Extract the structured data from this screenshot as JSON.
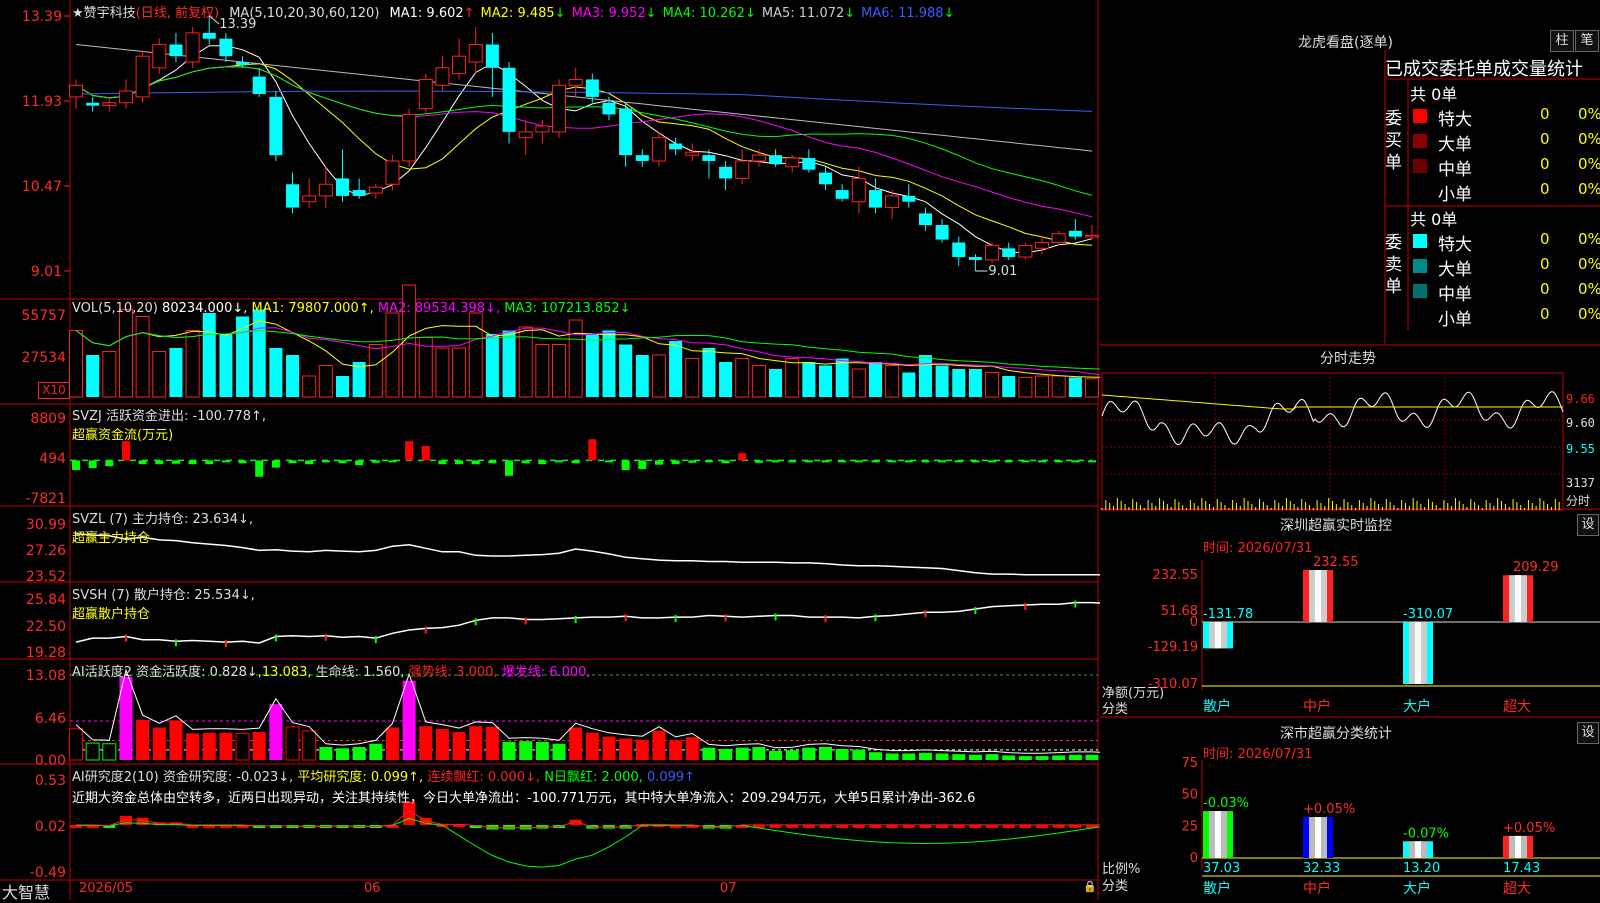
{
  "app": {
    "brand": "大智慧"
  },
  "header": {
    "stock": "★赞宇科技",
    "period": "(日线, 前复权)",
    "ma_label": "MA(5,10,20,30,60,120)",
    "mas": [
      {
        "name": "MA1:",
        "value": "9.602",
        "arrow": "↑",
        "color": "#ffffff"
      },
      {
        "name": "MA2:",
        "value": "9.485",
        "arrow": "↓",
        "color": "#ffff00"
      },
      {
        "name": "MA3:",
        "value": "9.952",
        "arrow": "↓",
        "color": "#ff00ff"
      },
      {
        "name": "MA4:",
        "value": "10.262",
        "arrow": "↓",
        "color": "#00ff00"
      },
      {
        "name": "MA5:",
        "value": "11.072",
        "arrow": "↓",
        "color": "#cccccc"
      },
      {
        "name": "MA6:",
        "value": "11.988",
        "arrow": "↓",
        "color": "#3b5bff"
      }
    ]
  },
  "panels": {
    "vol": {
      "title": "VOL(5,10,20)",
      "value": "80234.000↓,",
      "ma1": "MA1: 79807.000↑,",
      "ma2": "MA2: 89534.398↓,",
      "ma3": "MA3: 107213.852↓",
      "unit": "X10"
    },
    "svzj": {
      "title": "SVZJ  活跃资金进出: -100.778↑,",
      "sub": "超赢资金流(万元)"
    },
    "svzl": {
      "title": "SVZL (7) 主力持仓: 23.634↓,",
      "sub": "超赢主力持仓"
    },
    "svsh": {
      "title": "SVSH (7) 散户持仓: 25.534↓,",
      "sub": "超赢散户持仓"
    },
    "ai1": {
      "title": "AI活跃度2 资金活跃度: 0.828↓,",
      "v2": "13.083,",
      "life": "生命线: 1.560,",
      "strong": "强势线: 3.000,",
      "burst": "爆发线: 6.000,"
    },
    "ai2": {
      "title": "AI研究度2(10) 资金研究度: -0.023↓,",
      "avg": "平均研究度: 0.099↑,",
      "lian": "连续飘红: 0.000↓,",
      "nday": "N日飘红: 2.000,",
      "last": "0.099↑",
      "comment": "近期大资金总体由空转多，近两日出现异动，关注其持续性，今日大单净流出：-100.771万元，其中特大单净流入：209.294万元，大单5日累计净出-362.6"
    }
  },
  "xaxis": {
    "labels": [
      "2026/05",
      "06",
      "07"
    ]
  },
  "right": {
    "lhb_title": "龙虎看盘(逐单)",
    "btn_zhu": "柱",
    "btn_bi": "笔",
    "stat_title": "已成交委托单成交量统计",
    "buy_label": "委买单",
    "sell_label": "委卖单",
    "buy_total": "共 0单",
    "sell_total": "共 0单",
    "buy_rows": [
      {
        "name": "特大",
        "count": "0",
        "pct": "0%",
        "color": "#ff0000"
      },
      {
        "name": "大单",
        "count": "0",
        "pct": "0%",
        "color": "#8b0000"
      },
      {
        "name": "中单",
        "count": "0",
        "pct": "0%",
        "color": "#6b0000"
      },
      {
        "name": "小单",
        "count": "0",
        "pct": "0%",
        "color": ""
      }
    ],
    "sell_rows": [
      {
        "name": "特大",
        "count": "0",
        "pct": "0%",
        "color": "#00ffff"
      },
      {
        "name": "大单",
        "count": "0",
        "pct": "0%",
        "color": "#008b8b"
      },
      {
        "name": "中单",
        "count": "0",
        "pct": "0%",
        "color": "#007070"
      },
      {
        "name": "小单",
        "count": "0",
        "pct": "0%",
        "color": ""
      }
    ],
    "fenshi_title": "分时走势",
    "fenshi_ticks": [
      "9.66",
      "9.60",
      "9.55"
    ],
    "fenshi_vol": "3137",
    "fenshi_unit": "分时",
    "monitor_title": "深圳超赢实时监控",
    "monitor_btn": "设",
    "monitor_time": "时间: 2026/07/31",
    "monitor_yticks": [
      "232.55",
      "51.68",
      "0",
      "-129.19",
      "-310.07"
    ],
    "monitor_ylabel": "净额(万元)",
    "monitor_xlabel": "分类",
    "monitor_cats": [
      "散户",
      "中户",
      "大户",
      "超大"
    ],
    "monitor_labels": [
      "-131.78",
      "232.55",
      "-310.07",
      "209.29"
    ],
    "class_title": "深市超赢分类统计",
    "class_btn": "设",
    "class_time": "时间: 2026/07/31",
    "class_yticks": [
      "75",
      "50",
      "25",
      "0"
    ],
    "class_ylabel": "比例%",
    "class_xlabel": "分类",
    "class_cats": [
      "散户",
      "中户",
      "大户",
      "超大"
    ],
    "class_top": [
      "-0.03%",
      "+0.05%",
      "-0.07%",
      "+0.05%"
    ],
    "class_bottom": [
      "37.03",
      "32.33",
      "13.20",
      "17.43"
    ]
  },
  "chart_data": [
    {
      "type": "candlestick",
      "title": "赞宇科技 (日线, 前复权)",
      "yticks": [
        "13.39",
        "11.93",
        "10.47",
        "9.01"
      ],
      "price_ticks": [
        13.39,
        11.93,
        10.47,
        9.01
      ],
      "annotations": [
        "13.39",
        "9.01"
      ],
      "ohlc": [
        [
          12.0,
          12.3,
          11.8,
          12.2
        ],
        [
          11.9,
          12.0,
          11.75,
          11.85
        ],
        [
          11.85,
          12.0,
          11.75,
          11.9
        ],
        [
          11.9,
          12.3,
          11.8,
          12.1
        ],
        [
          12.0,
          12.8,
          11.9,
          12.7
        ],
        [
          12.5,
          13.0,
          12.4,
          12.9
        ],
        [
          12.9,
          13.1,
          12.6,
          12.7
        ],
        [
          12.6,
          13.2,
          12.5,
          13.1
        ],
        [
          13.1,
          13.39,
          12.9,
          13.0
        ],
        [
          13.0,
          13.1,
          12.6,
          12.7
        ],
        [
          12.6,
          12.7,
          12.5,
          12.55
        ],
        [
          12.35,
          12.5,
          12.0,
          12.05
        ],
        [
          12.0,
          12.1,
          10.9,
          11.0
        ],
        [
          10.5,
          10.7,
          10.0,
          10.1
        ],
        [
          10.2,
          10.6,
          10.1,
          10.3
        ],
        [
          10.3,
          10.8,
          10.1,
          10.5
        ],
        [
          10.6,
          11.1,
          10.2,
          10.3
        ],
        [
          10.4,
          10.6,
          10.25,
          10.3
        ],
        [
          10.35,
          10.5,
          10.25,
          10.45
        ],
        [
          10.5,
          11.0,
          10.4,
          10.9
        ],
        [
          10.9,
          11.8,
          10.8,
          11.7
        ],
        [
          11.8,
          12.4,
          11.7,
          12.3
        ],
        [
          12.2,
          12.7,
          12.1,
          12.5
        ],
        [
          12.4,
          13.0,
          12.3,
          12.7
        ],
        [
          12.6,
          13.2,
          12.4,
          12.9
        ],
        [
          12.9,
          13.1,
          12.0,
          12.5
        ],
        [
          12.5,
          12.6,
          11.2,
          11.4
        ],
        [
          11.3,
          11.6,
          11.0,
          11.4
        ],
        [
          11.4,
          11.6,
          11.2,
          11.5
        ],
        [
          11.4,
          12.3,
          11.3,
          12.2
        ],
        [
          12.2,
          12.5,
          12.0,
          12.3
        ],
        [
          12.3,
          12.4,
          11.9,
          12.0
        ],
        [
          11.9,
          12.0,
          11.6,
          11.7
        ],
        [
          11.8,
          11.9,
          10.8,
          11.0
        ],
        [
          11.0,
          11.1,
          10.8,
          10.9
        ],
        [
          10.9,
          11.4,
          10.8,
          11.3
        ],
        [
          11.2,
          11.3,
          11.0,
          11.1
        ],
        [
          11.0,
          11.2,
          10.9,
          11.05
        ],
        [
          11.0,
          11.1,
          10.6,
          10.9
        ],
        [
          10.8,
          10.9,
          10.4,
          10.6
        ],
        [
          10.6,
          11.1,
          10.5,
          10.9
        ],
        [
          10.9,
          11.1,
          10.8,
          11.0
        ],
        [
          11.0,
          11.1,
          10.8,
          10.85
        ],
        [
          10.8,
          11.0,
          10.7,
          10.95
        ],
        [
          10.95,
          11.1,
          10.7,
          10.75
        ],
        [
          10.7,
          10.8,
          10.4,
          10.5
        ],
        [
          10.4,
          10.5,
          10.2,
          10.25
        ],
        [
          10.2,
          10.8,
          10.0,
          10.6
        ],
        [
          10.4,
          10.6,
          10.0,
          10.1
        ],
        [
          10.1,
          10.4,
          9.9,
          10.3
        ],
        [
          10.3,
          10.5,
          10.1,
          10.2
        ],
        [
          10.0,
          10.1,
          9.7,
          9.8
        ],
        [
          9.8,
          9.9,
          9.5,
          9.55
        ],
        [
          9.5,
          9.6,
          9.1,
          9.25
        ],
        [
          9.25,
          9.3,
          9.01,
          9.2
        ],
        [
          9.2,
          9.5,
          9.15,
          9.45
        ],
        [
          9.4,
          9.5,
          9.2,
          9.25
        ],
        [
          9.25,
          9.5,
          9.2,
          9.45
        ],
        [
          9.4,
          9.6,
          9.3,
          9.5
        ],
        [
          9.5,
          9.7,
          9.45,
          9.65
        ],
        [
          9.7,
          9.9,
          9.55,
          9.6
        ],
        [
          9.6,
          9.8,
          9.55,
          9.62
        ]
      ]
    },
    {
      "type": "bar",
      "title": "VOL(5,10,20)",
      "yticks": [
        "55757",
        "27534"
      ],
      "values": [
        95,
        60,
        65,
        125,
        115,
        65,
        70,
        95,
        120,
        90,
        115,
        125,
        70,
        60,
        30,
        45,
        30,
        50,
        75,
        120,
        160,
        85,
        70,
        70,
        120,
        90,
        95,
        100,
        75,
        75,
        110,
        90,
        95,
        75,
        60,
        60,
        80,
        55,
        70,
        50,
        55,
        45,
        40,
        55,
        50,
        45,
        55,
        40,
        50,
        45,
        35,
        60,
        45,
        40,
        40,
        35,
        30,
        28,
        30,
        30,
        28,
        26,
        25,
        26
      ]
    },
    {
      "type": "bar",
      "title": "SVZJ 活跃资金进出",
      "yticks": [
        "8809",
        "494",
        "-7821"
      ],
      "values": [
        -2000,
        -1600,
        -1200,
        4000,
        -800,
        -800,
        -700,
        -800,
        -800,
        -200,
        -600,
        -3400,
        -1500,
        -600,
        -800,
        -200,
        -600,
        -1000,
        -500,
        -400,
        4000,
        3000,
        -800,
        -800,
        -800,
        -600,
        -3200,
        -600,
        -800,
        -200,
        -600,
        4400,
        -400,
        -2000,
        -1800,
        -900,
        -800,
        -500,
        -400,
        -600,
        1500,
        -500,
        -200,
        -300,
        -200,
        -200,
        -200,
        -200,
        -200,
        -200,
        -200,
        -200,
        -200,
        -200,
        -200,
        -200,
        -200,
        -200,
        -200,
        -200,
        -200,
        -200,
        -200,
        -200
      ]
    },
    {
      "type": "line",
      "title": "SVZL 主力持仓",
      "yticks": [
        "30.99",
        "27.26",
        "23.52"
      ],
      "values": [
        29.6,
        29.4,
        29.3,
        28.8,
        29.1,
        28.7,
        28.6,
        28.3,
        28.1,
        27.9,
        27.6,
        27.2,
        27.3,
        27.1,
        27.0,
        27.2,
        27.1,
        27.0,
        27.2,
        27.8,
        28.0,
        27.5,
        27.0,
        27.0,
        26.5,
        26.4,
        26.4,
        26.5,
        26.6,
        26.8,
        27.4,
        27.1,
        26.7,
        26.2,
        26.0,
        25.8,
        25.7,
        25.7,
        25.6,
        25.6,
        25.5,
        25.5,
        25.5,
        25.4,
        25.4,
        25.3,
        25.1,
        25.0,
        25.0,
        24.9,
        24.8,
        24.7,
        24.6,
        24.3,
        24.0,
        23.8,
        23.8,
        23.7,
        23.7,
        23.7,
        23.7,
        23.7,
        23.7,
        23.6
      ]
    },
    {
      "type": "line",
      "title": "SVSH 散户持仓",
      "yticks": [
        "25.84",
        "22.50",
        "19.28"
      ],
      "values": [
        20.5,
        21.0,
        21.0,
        21.2,
        20.8,
        20.8,
        20.6,
        20.7,
        20.6,
        20.5,
        20.6,
        20.4,
        21.2,
        21.3,
        21.2,
        21.3,
        21.1,
        21.2,
        21.0,
        21.6,
        22.0,
        22.2,
        22.3,
        22.6,
        23.2,
        23.5,
        23.5,
        23.3,
        23.3,
        23.4,
        23.5,
        23.6,
        23.6,
        23.7,
        23.5,
        23.5,
        23.6,
        23.6,
        23.8,
        23.7,
        23.6,
        23.7,
        23.8,
        23.8,
        23.6,
        23.6,
        23.6,
        23.5,
        23.7,
        23.8,
        24.0,
        24.2,
        24.2,
        24.3,
        24.6,
        24.9,
        25.0,
        25.1,
        25.2,
        25.2,
        25.4,
        25.4,
        25.3,
        25.5
      ]
    },
    {
      "type": "bar",
      "title": "AI活跃度2",
      "yticks": [
        "13.08",
        "6.46",
        "0.00"
      ],
      "values": [
        4.8,
        2.6,
        2.5,
        12.8,
        6.2,
        5.0,
        6.1,
        4.1,
        4.2,
        4.2,
        4.1,
        4.3,
        8.6,
        5.1,
        4.5,
        2.0,
        1.8,
        2.0,
        2.5,
        5.0,
        12.2,
        5.2,
        4.8,
        4.3,
        5.2,
        5.1,
        2.8,
        2.9,
        2.8,
        2.5,
        5.0,
        4.2,
        3.6,
        3.3,
        3.1,
        4.5,
        3.0,
        3.5,
        1.9,
        1.7,
        1.9,
        2.0,
        1.4,
        1.5,
        1.9,
        2.0,
        1.7,
        1.6,
        1.2,
        1.0,
        1.0,
        1.1,
        1.0,
        0.9,
        0.8,
        0.9,
        0.7,
        0.6,
        0.6,
        0.7,
        0.8,
        0.8,
        0.7,
        0.8
      ],
      "lines": [
        "生命线: 1.560",
        "强势线: 3.000",
        "爆发线: 6.000"
      ]
    },
    {
      "type": "bar",
      "title": "AI研究度2(10)",
      "yticks": [
        "0.53",
        "0.02",
        "-0.49"
      ],
      "values": [
        0.02,
        0.02,
        0.01,
        0.12,
        0.1,
        0.05,
        0.05,
        0.02,
        0.02,
        0.02,
        0.02,
        0.0,
        0.0,
        0.0,
        -0.01,
        -0.01,
        0.0,
        -0.01,
        -0.01,
        0.02,
        0.28,
        0.1,
        0.03,
        0.03,
        0.01,
        -0.03,
        -0.03,
        -0.03,
        -0.02,
        -0.01,
        0.08,
        -0.02,
        -0.02,
        -0.02,
        0.03,
        0.03,
        0.02,
        0.02,
        -0.02,
        -0.02,
        0.02,
        0.02,
        0.02,
        0.02,
        0.02,
        0.02,
        0.02,
        0.02,
        0.02,
        0.02,
        0.02,
        0.02,
        0.02,
        0.02,
        0.02,
        0.02,
        0.02,
        0.02,
        0.02,
        0.02,
        0.02,
        0.02,
        0.02,
        0.02
      ]
    },
    {
      "type": "bar",
      "title": "深圳超赢实时监控",
      "categories": [
        "散户",
        "中户",
        "大户",
        "超大"
      ],
      "values": [
        -131.78,
        232.55,
        -310.07,
        209.29
      ],
      "ylabel": "净额(万元)",
      "xlabel": "分类",
      "ylim": [
        -310.07,
        232.55
      ]
    },
    {
      "type": "bar",
      "title": "深市超赢分类统计",
      "categories": [
        "散户",
        "中户",
        "大户",
        "超大"
      ],
      "values": [
        37.03,
        32.33,
        13.2,
        17.43
      ],
      "ylabel": "比例%",
      "xlabel": "分类",
      "ylim": [
        0,
        75
      ]
    }
  ]
}
